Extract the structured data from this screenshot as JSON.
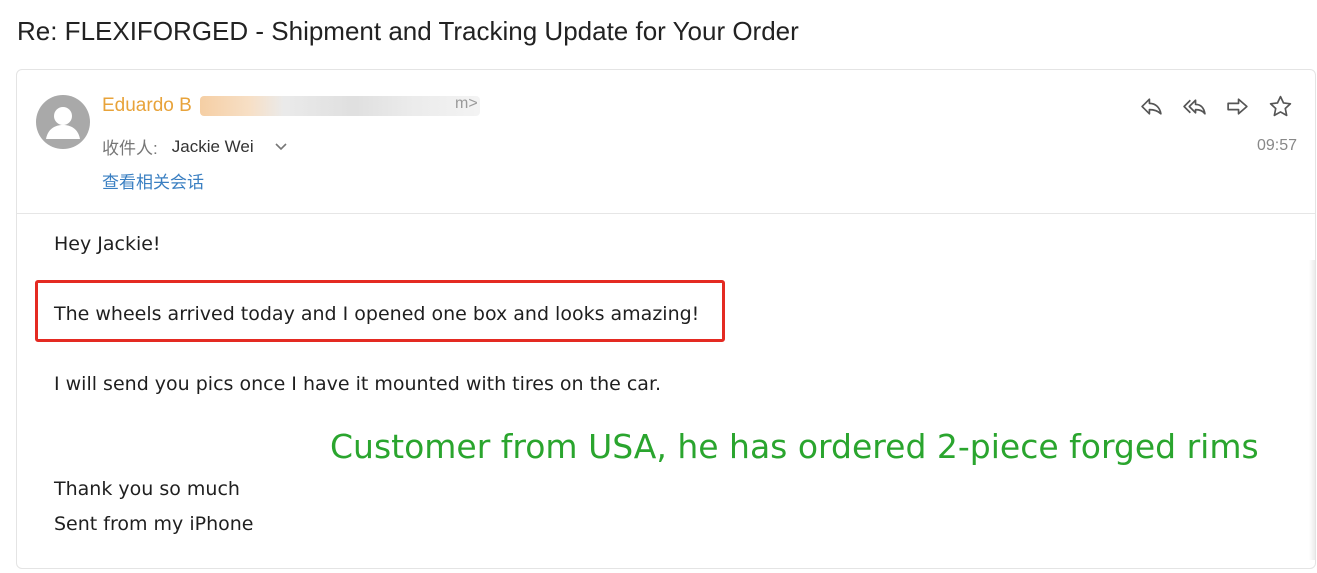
{
  "subject": "Re: FLEXIFORGED - Shipment and Tracking Update for Your Order",
  "header": {
    "sender_name": "Eduardo B",
    "sender_email_tail": "m>",
    "recipient_label": "收件人:",
    "recipient_name": "Jackie Wei",
    "related_link": "查看相关会话",
    "time": "09:57",
    "actions": [
      "reply-icon",
      "reply-all-icon",
      "forward-icon",
      "star-icon"
    ]
  },
  "body": {
    "greeting": "Hey Jackie!",
    "highlighted_line": "The wheels arrived today and I opened one box and looks amazing!",
    "line_pics": "I will send you pics once I have it mounted with tires on the car.",
    "thanks": "Thank you so much",
    "signature": "Sent from my iPhone"
  },
  "annotation": {
    "text": "Customer from USA, he has ordered 2-piece forged rims",
    "color": "#2aa52e"
  },
  "colors": {
    "sender": "#e8a33a",
    "link": "#3a7fc2",
    "highlight_border": "#e42a22"
  }
}
